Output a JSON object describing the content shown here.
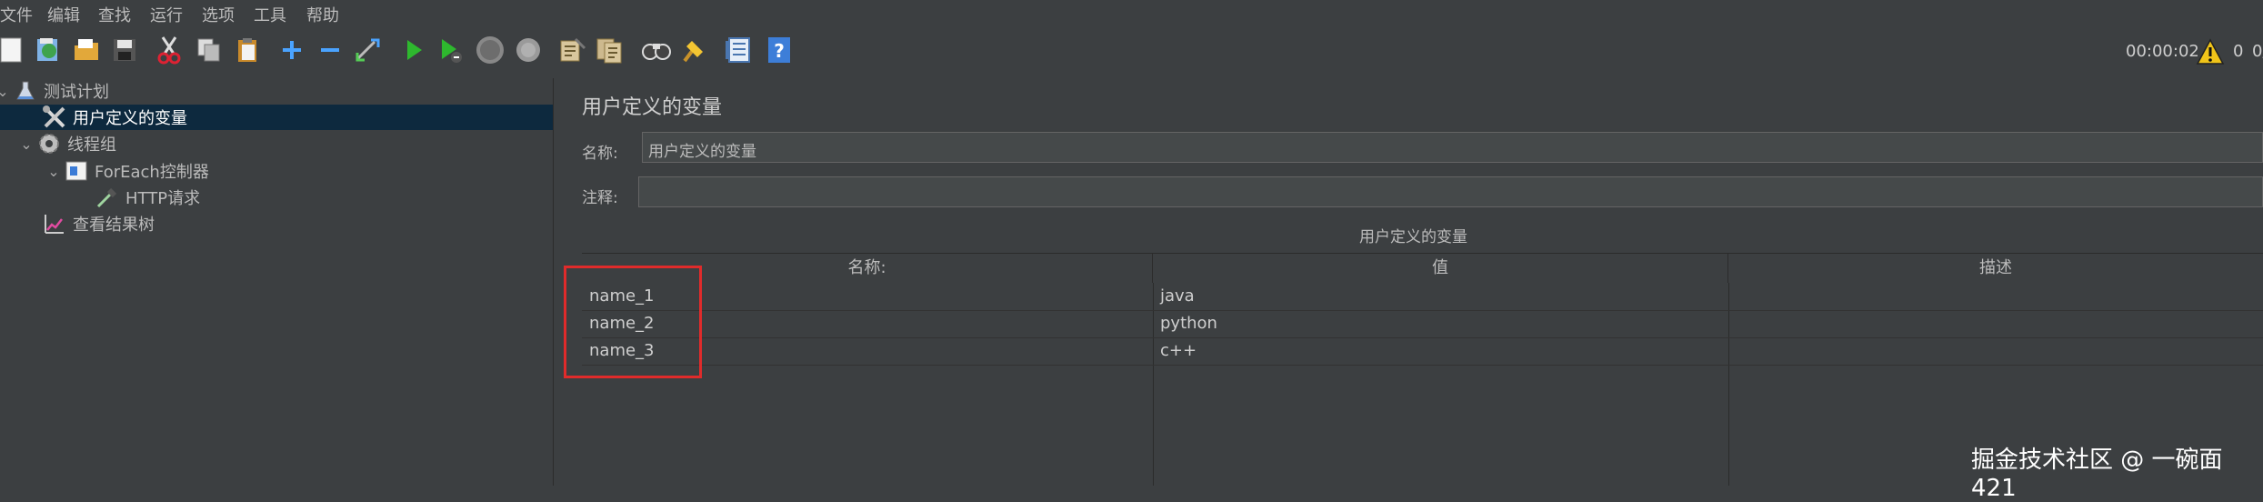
{
  "menu": [
    "文件",
    "编辑",
    "查找",
    "运行",
    "选项",
    "工具",
    "帮助"
  ],
  "toolbar": {
    "icons": [
      "new-icon",
      "template-icon",
      "open-icon",
      "save-icon",
      "cut-icon",
      "copy-icon",
      "paste-icon",
      "expand-icon",
      "collapse-icon",
      "toggle-icon",
      "start-icon",
      "start-no-pause-icon",
      "stop-icon",
      "shutdown-icon",
      "clear-icon",
      "clear-all-icon",
      "search-icon",
      "reset-search-icon",
      "function-helper-icon",
      "help-icon"
    ],
    "timer": "00:00:02",
    "warning_count": "0",
    "thread_count": "0/"
  },
  "tree": {
    "items": [
      {
        "label": "测试计划",
        "icon": "flask-icon"
      },
      {
        "label": "用户定义的变量",
        "icon": "tools-icon"
      },
      {
        "label": "线程组",
        "icon": "gear-icon"
      },
      {
        "label": "ForEach控制器",
        "icon": "controller-icon"
      },
      {
        "label": "HTTP请求",
        "icon": "pipette-icon"
      },
      {
        "label": "查看结果树",
        "icon": "chart-icon"
      }
    ]
  },
  "panel": {
    "title": "用户定义的变量",
    "name_label": "名称:",
    "name_value": "用户定义的变量",
    "comment_label": "注释:",
    "comment_value": "",
    "table_title": "用户定义的变量",
    "columns": [
      "名称:",
      "值",
      "描述"
    ],
    "rows": [
      {
        "name": "name_1",
        "value": "java",
        "desc": ""
      },
      {
        "name": "name_2",
        "value": "python",
        "desc": ""
      },
      {
        "name": "name_3",
        "value": "c++",
        "desc": ""
      }
    ]
  },
  "watermark": "掘金技术社区 @ 一碗面421",
  "colors": {
    "background": "#3c3f41",
    "selection": "#0d293e",
    "highlight": "#e02b2b"
  }
}
